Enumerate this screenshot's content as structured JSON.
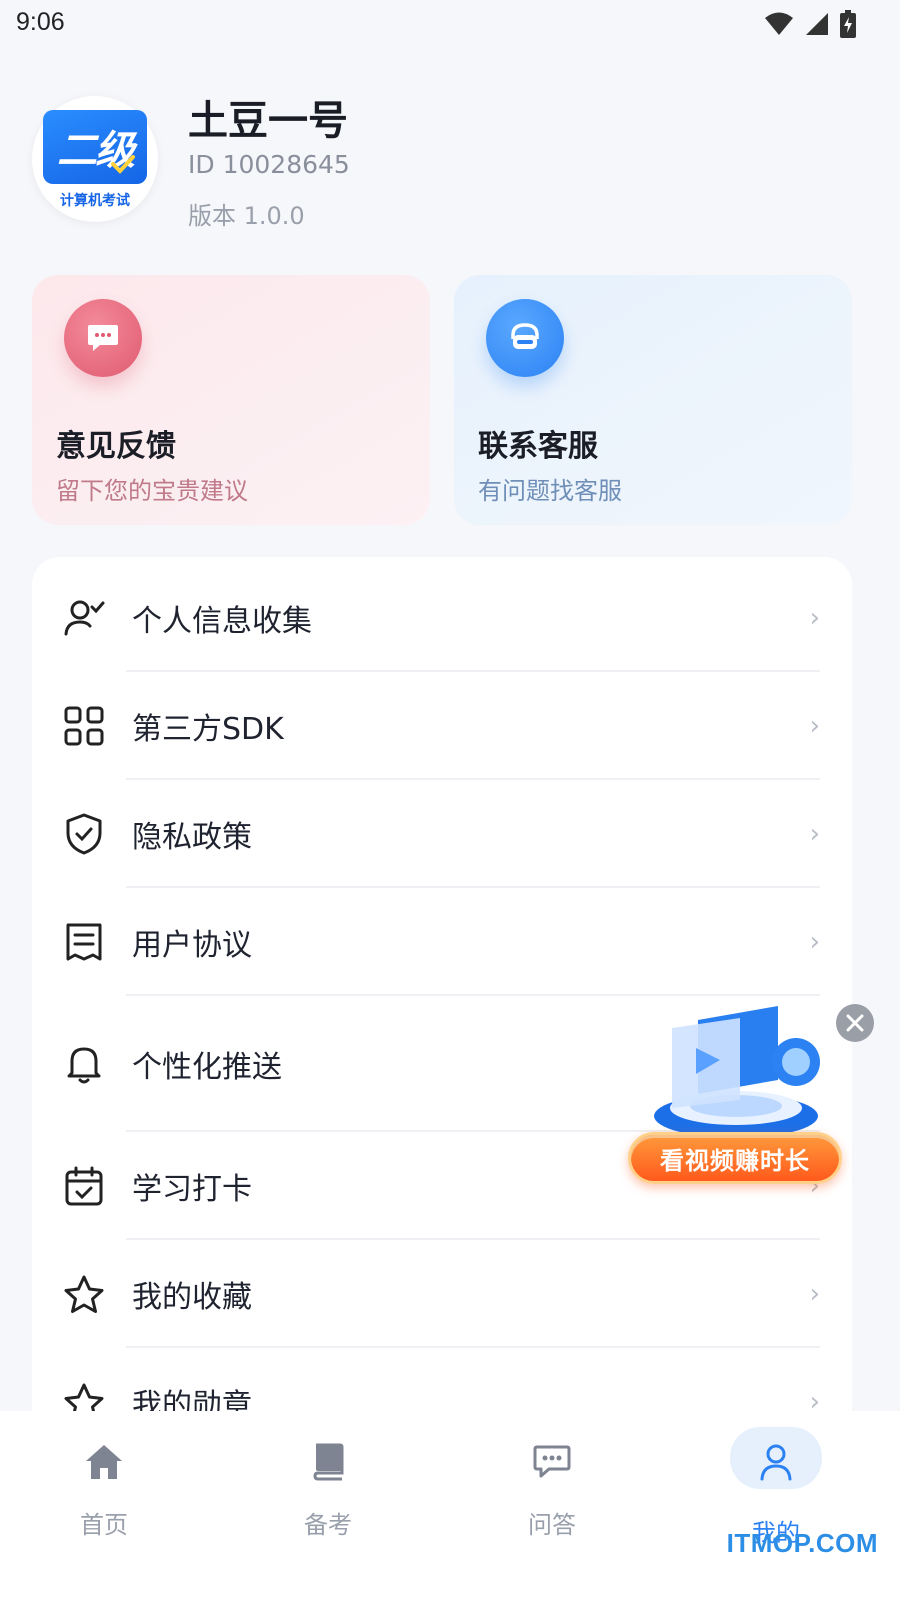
{
  "status_bar": {
    "time": "9:06"
  },
  "profile": {
    "avatar_badge": "二级",
    "avatar_caption": "计算机考试",
    "name": "土豆一号",
    "id": "ID 10028645",
    "version": "版本 1.0.0"
  },
  "cards": {
    "feedback": {
      "title": "意见反馈",
      "subtitle": "留下您的宝贵建议"
    },
    "service": {
      "title": "联系客服",
      "subtitle": "有问题找客服"
    }
  },
  "menu": {
    "items": [
      {
        "label": "个人信息收集",
        "icon": "user-check-icon"
      },
      {
        "label": "第三方SDK",
        "icon": "grid-icon"
      },
      {
        "label": "隐私政策",
        "icon": "shield-check-icon"
      },
      {
        "label": "用户协议",
        "icon": "document-icon"
      },
      {
        "label": "个性化推送",
        "icon": "bell-icon"
      },
      {
        "label": "学习打卡",
        "icon": "calendar-check-icon"
      },
      {
        "label": "我的收藏",
        "icon": "star-icon"
      },
      {
        "label": "我的勋章",
        "icon": "star-icon"
      }
    ],
    "arrow": "›"
  },
  "promo": {
    "button_label": "看视频赚时长"
  },
  "tabbar": {
    "tabs": [
      {
        "label": "首页",
        "icon": "home-icon"
      },
      {
        "label": "备考",
        "icon": "book-icon"
      },
      {
        "label": "问答",
        "icon": "chat-icon"
      },
      {
        "label": "我的",
        "icon": "user-icon",
        "active": true
      }
    ]
  },
  "watermark": "ITMOP.COM",
  "colors": {
    "accent": "#2c82f3",
    "feedback": "#e05a70",
    "promo": "#ff5a1c"
  }
}
